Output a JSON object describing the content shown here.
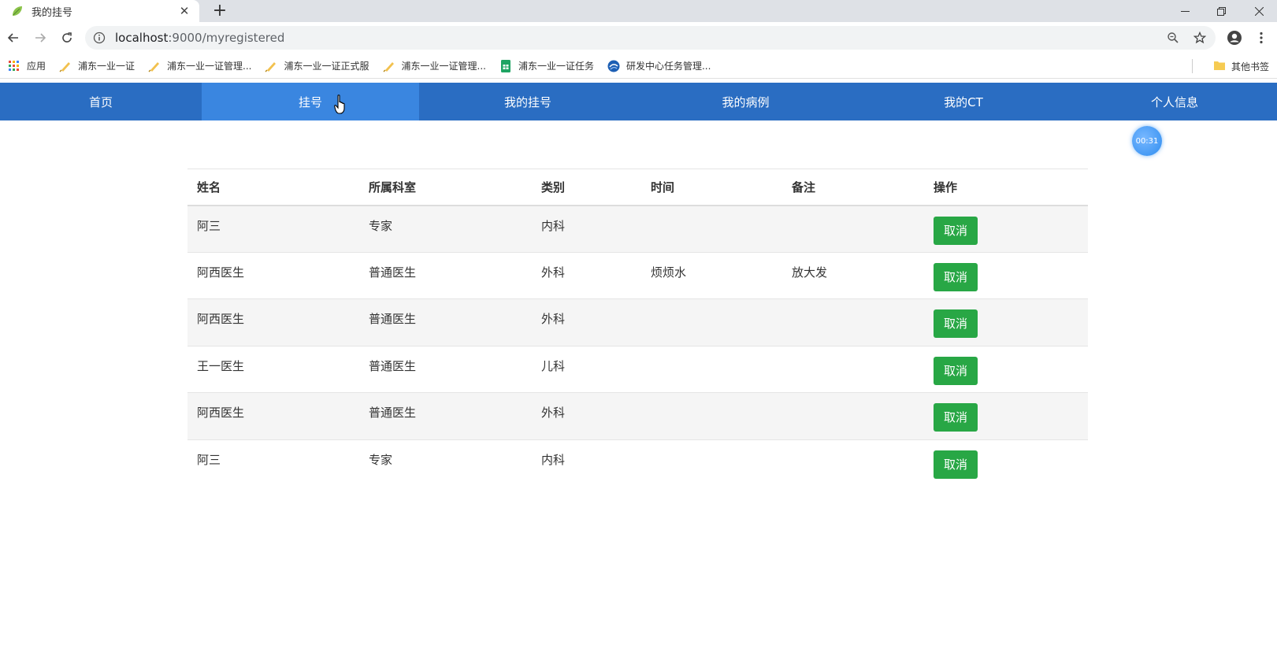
{
  "browser": {
    "tab_title": "我的挂号",
    "url_host": "localhost",
    "url_path": ":9000/myregistered"
  },
  "bookmarks": [
    {
      "label": "应用",
      "icon": "apps-grid-icon"
    },
    {
      "label": "浦东一业一证",
      "icon": "pen-icon"
    },
    {
      "label": "浦东一业一证管理...",
      "icon": "pen-icon"
    },
    {
      "label": "浦东一业一证正式服",
      "icon": "pen-icon"
    },
    {
      "label": "浦东一业一证管理...",
      "icon": "pen-icon"
    },
    {
      "label": "浦东一业一证任务",
      "icon": "sheet-icon"
    },
    {
      "label": "研发中心任务管理...",
      "icon": "globe-icon"
    }
  ],
  "bookmarks_other": "其他书签",
  "nav": [
    {
      "label": "首页",
      "active": false
    },
    {
      "label": "挂号",
      "active": true
    },
    {
      "label": "我的挂号",
      "active": false
    },
    {
      "label": "我的病例",
      "active": false
    },
    {
      "label": "我的CT",
      "active": false
    },
    {
      "label": "个人信息",
      "active": false
    }
  ],
  "timer": "00:31",
  "table": {
    "headers": [
      "姓名",
      "所属科室",
      "类别",
      "时间",
      "备注",
      "操作"
    ],
    "rows": [
      {
        "name": "阿三",
        "dept": "专家",
        "category": "内科",
        "time": "",
        "note": "",
        "action": "取消"
      },
      {
        "name": "阿西医生",
        "dept": "普通医生",
        "category": "外科",
        "time": "烦烦水",
        "note": "放大发",
        "action": "取消"
      },
      {
        "name": "阿西医生",
        "dept": "普通医生",
        "category": "外科",
        "time": "",
        "note": "",
        "action": "取消"
      },
      {
        "name": "王一医生",
        "dept": "普通医生",
        "category": "儿科",
        "time": "",
        "note": "",
        "action": "取消"
      },
      {
        "name": "阿西医生",
        "dept": "普通医生",
        "category": "外科",
        "time": "",
        "note": "",
        "action": "取消"
      },
      {
        "name": "阿三",
        "dept": "专家",
        "category": "内科",
        "time": "",
        "note": "",
        "action": "取消"
      }
    ]
  },
  "colors": {
    "nav_bg": "#2a6dc2",
    "nav_active": "#3a86e0",
    "cancel_btn": "#28a745"
  }
}
